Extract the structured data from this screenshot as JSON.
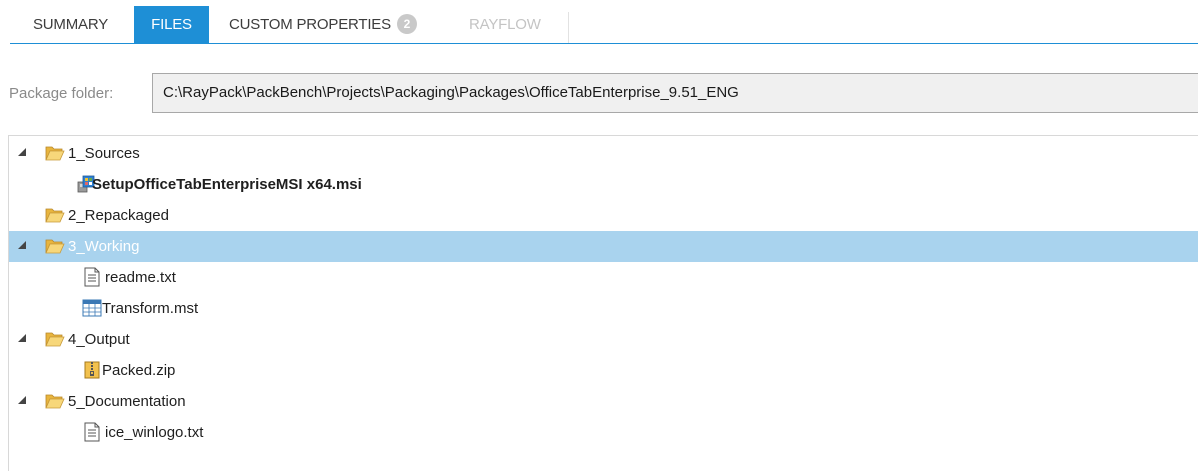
{
  "tabs": [
    {
      "label": "SUMMARY",
      "active": false,
      "disabled": false
    },
    {
      "label": "FILES",
      "active": true,
      "disabled": false
    },
    {
      "label": "CUSTOM PROPERTIES",
      "badge": "2",
      "active": false,
      "disabled": false
    },
    {
      "label": "RAYFLOW",
      "active": false,
      "disabled": true
    }
  ],
  "package_folder": {
    "label": "Package folder:",
    "value": "C:\\RayPack\\PackBench\\Projects\\Packaging\\Packages\\OfficeTabEnterprise_9.51_ENG"
  },
  "tree": {
    "nodes": [
      {
        "label": "1_Sources",
        "type": "folder",
        "expanded": true
      },
      {
        "label": "SetupOfficeTabEnterpriseMSI x64.msi",
        "type": "msi-file"
      },
      {
        "label": "2_Repackaged",
        "type": "folder",
        "expanded": false
      },
      {
        "label": "3_Working",
        "type": "folder",
        "expanded": true,
        "selected": true
      },
      {
        "label": "readme.txt",
        "type": "text-file"
      },
      {
        "label": "Transform.mst",
        "type": "transform-file"
      },
      {
        "label": "4_Output",
        "type": "folder",
        "expanded": true
      },
      {
        "label": "Packed.zip",
        "type": "zip-file"
      },
      {
        "label": "5_Documentation",
        "type": "folder",
        "expanded": true
      },
      {
        "label": "ice_winlogo.txt",
        "type": "text-file"
      }
    ]
  },
  "colors": {
    "accent": "#1e8fd6",
    "selection": "#a9d3ee",
    "folder": "#f4c95d"
  }
}
